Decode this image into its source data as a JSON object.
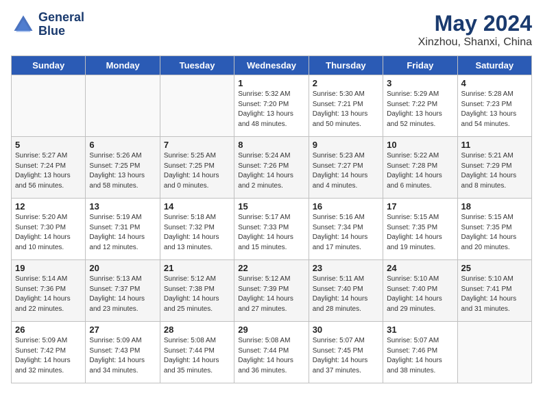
{
  "header": {
    "logo_line1": "General",
    "logo_line2": "Blue",
    "month": "May 2024",
    "location": "Xinzhou, Shanxi, China"
  },
  "days_of_week": [
    "Sunday",
    "Monday",
    "Tuesday",
    "Wednesday",
    "Thursday",
    "Friday",
    "Saturday"
  ],
  "weeks": [
    [
      {
        "day": "",
        "info": ""
      },
      {
        "day": "",
        "info": ""
      },
      {
        "day": "",
        "info": ""
      },
      {
        "day": "1",
        "info": "Sunrise: 5:32 AM\nSunset: 7:20 PM\nDaylight: 13 hours\nand 48 minutes."
      },
      {
        "day": "2",
        "info": "Sunrise: 5:30 AM\nSunset: 7:21 PM\nDaylight: 13 hours\nand 50 minutes."
      },
      {
        "day": "3",
        "info": "Sunrise: 5:29 AM\nSunset: 7:22 PM\nDaylight: 13 hours\nand 52 minutes."
      },
      {
        "day": "4",
        "info": "Sunrise: 5:28 AM\nSunset: 7:23 PM\nDaylight: 13 hours\nand 54 minutes."
      }
    ],
    [
      {
        "day": "5",
        "info": "Sunrise: 5:27 AM\nSunset: 7:24 PM\nDaylight: 13 hours\nand 56 minutes."
      },
      {
        "day": "6",
        "info": "Sunrise: 5:26 AM\nSunset: 7:25 PM\nDaylight: 13 hours\nand 58 minutes."
      },
      {
        "day": "7",
        "info": "Sunrise: 5:25 AM\nSunset: 7:25 PM\nDaylight: 14 hours\nand 0 minutes."
      },
      {
        "day": "8",
        "info": "Sunrise: 5:24 AM\nSunset: 7:26 PM\nDaylight: 14 hours\nand 2 minutes."
      },
      {
        "day": "9",
        "info": "Sunrise: 5:23 AM\nSunset: 7:27 PM\nDaylight: 14 hours\nand 4 minutes."
      },
      {
        "day": "10",
        "info": "Sunrise: 5:22 AM\nSunset: 7:28 PM\nDaylight: 14 hours\nand 6 minutes."
      },
      {
        "day": "11",
        "info": "Sunrise: 5:21 AM\nSunset: 7:29 PM\nDaylight: 14 hours\nand 8 minutes."
      }
    ],
    [
      {
        "day": "12",
        "info": "Sunrise: 5:20 AM\nSunset: 7:30 PM\nDaylight: 14 hours\nand 10 minutes."
      },
      {
        "day": "13",
        "info": "Sunrise: 5:19 AM\nSunset: 7:31 PM\nDaylight: 14 hours\nand 12 minutes."
      },
      {
        "day": "14",
        "info": "Sunrise: 5:18 AM\nSunset: 7:32 PM\nDaylight: 14 hours\nand 13 minutes."
      },
      {
        "day": "15",
        "info": "Sunrise: 5:17 AM\nSunset: 7:33 PM\nDaylight: 14 hours\nand 15 minutes."
      },
      {
        "day": "16",
        "info": "Sunrise: 5:16 AM\nSunset: 7:34 PM\nDaylight: 14 hours\nand 17 minutes."
      },
      {
        "day": "17",
        "info": "Sunrise: 5:15 AM\nSunset: 7:35 PM\nDaylight: 14 hours\nand 19 minutes."
      },
      {
        "day": "18",
        "info": "Sunrise: 5:15 AM\nSunset: 7:35 PM\nDaylight: 14 hours\nand 20 minutes."
      }
    ],
    [
      {
        "day": "19",
        "info": "Sunrise: 5:14 AM\nSunset: 7:36 PM\nDaylight: 14 hours\nand 22 minutes."
      },
      {
        "day": "20",
        "info": "Sunrise: 5:13 AM\nSunset: 7:37 PM\nDaylight: 14 hours\nand 23 minutes."
      },
      {
        "day": "21",
        "info": "Sunrise: 5:12 AM\nSunset: 7:38 PM\nDaylight: 14 hours\nand 25 minutes."
      },
      {
        "day": "22",
        "info": "Sunrise: 5:12 AM\nSunset: 7:39 PM\nDaylight: 14 hours\nand 27 minutes."
      },
      {
        "day": "23",
        "info": "Sunrise: 5:11 AM\nSunset: 7:40 PM\nDaylight: 14 hours\nand 28 minutes."
      },
      {
        "day": "24",
        "info": "Sunrise: 5:10 AM\nSunset: 7:40 PM\nDaylight: 14 hours\nand 29 minutes."
      },
      {
        "day": "25",
        "info": "Sunrise: 5:10 AM\nSunset: 7:41 PM\nDaylight: 14 hours\nand 31 minutes."
      }
    ],
    [
      {
        "day": "26",
        "info": "Sunrise: 5:09 AM\nSunset: 7:42 PM\nDaylight: 14 hours\nand 32 minutes."
      },
      {
        "day": "27",
        "info": "Sunrise: 5:09 AM\nSunset: 7:43 PM\nDaylight: 14 hours\nand 34 minutes."
      },
      {
        "day": "28",
        "info": "Sunrise: 5:08 AM\nSunset: 7:44 PM\nDaylight: 14 hours\nand 35 minutes."
      },
      {
        "day": "29",
        "info": "Sunrise: 5:08 AM\nSunset: 7:44 PM\nDaylight: 14 hours\nand 36 minutes."
      },
      {
        "day": "30",
        "info": "Sunrise: 5:07 AM\nSunset: 7:45 PM\nDaylight: 14 hours\nand 37 minutes."
      },
      {
        "day": "31",
        "info": "Sunrise: 5:07 AM\nSunset: 7:46 PM\nDaylight: 14 hours\nand 38 minutes."
      },
      {
        "day": "",
        "info": ""
      }
    ]
  ]
}
